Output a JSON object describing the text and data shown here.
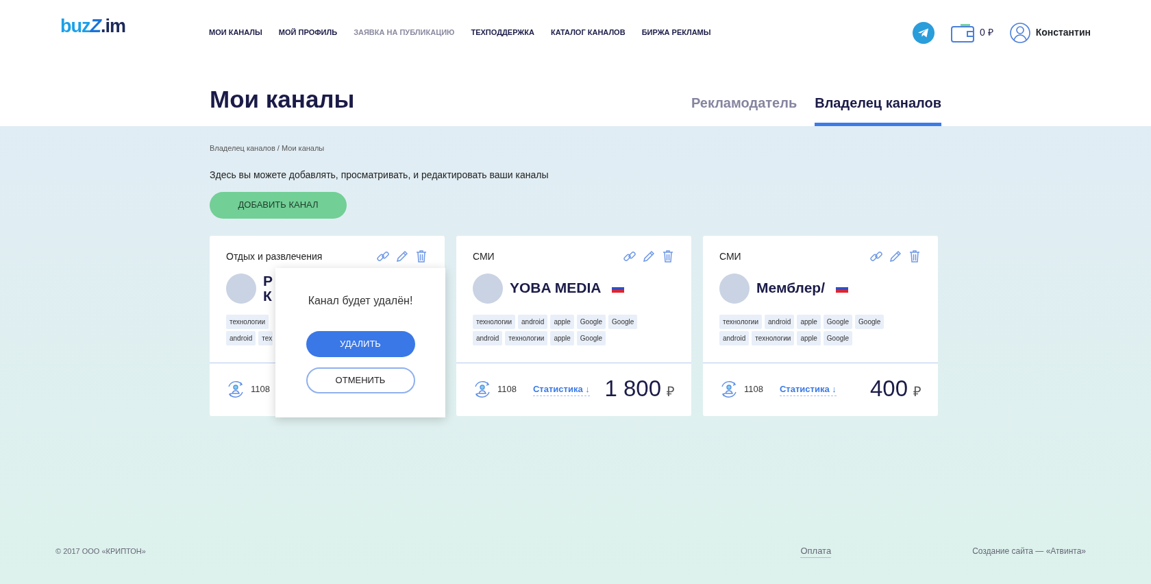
{
  "logo": {
    "main": "buz",
    "accent": "Z",
    "suffix": ".im"
  },
  "nav": [
    {
      "label": "МОИ КАНАЛЫ",
      "disabled": false
    },
    {
      "label": "МОЙ ПРОФИЛЬ",
      "disabled": false
    },
    {
      "label": "ЗАЯВКА НА ПУБЛИКАЦИЮ",
      "disabled": true
    },
    {
      "label": "ТЕХПОДДЕРЖКА",
      "disabled": false
    },
    {
      "label": "КАТАЛОГ КАНАЛОВ",
      "disabled": false
    },
    {
      "label": "БИРЖА РЕКЛАМЫ",
      "disabled": false
    }
  ],
  "balance": "0 ₽",
  "user": "Константин",
  "page_title": "Мои каналы",
  "tabs": [
    {
      "label": "Рекламодатель",
      "selected": false
    },
    {
      "label": "Владелец каналов",
      "selected": true
    }
  ],
  "breadcrumb": "Владелец каналов / Мои каналы",
  "description": "Здесь вы можете добавлять, просматривать, и редактировать ваши каналы",
  "add_button": "ДОБАВИТЬ КАНАЛ",
  "cards": [
    {
      "category": "Отдых и развлечения",
      "name_lines": [
        "Р",
        "К"
      ],
      "tag_rows": [
        [
          "технологии"
        ],
        [
          "android",
          "тех"
        ]
      ],
      "subscribers": "1108",
      "confirm": {
        "message": "Канал будет удалён!",
        "confirm_button": "УДАЛИТЬ",
        "cancel_button": "ОТМЕНИТЬ"
      }
    },
    {
      "category": "СМИ",
      "name_lines": [
        "YOBA MEDIA"
      ],
      "flag": true,
      "tag_rows": [
        [
          "технологии",
          "android",
          "apple",
          "Google",
          "Google"
        ],
        [
          "android",
          "технологии",
          "apple",
          "Google"
        ]
      ],
      "subscribers": "1108",
      "stats_link": "Статистика ↓",
      "price": "1 800",
      "currency": "₽"
    },
    {
      "category": "СМИ",
      "name_lines": [
        "Мемблер/"
      ],
      "flag": true,
      "tag_rows": [
        [
          "технологии",
          "android",
          "apple",
          "Google",
          "Google"
        ],
        [
          "android",
          "технологии",
          "apple",
          "Google"
        ]
      ],
      "subscribers": "1108",
      "stats_link": "Статистика ↓",
      "price": "400",
      "currency": "₽"
    }
  ],
  "footer": {
    "copyright": "© 2017 ООО «КРИПТОН»",
    "payment_link": "Оплата",
    "credit": "Создание сайта — «Атвинта»"
  }
}
